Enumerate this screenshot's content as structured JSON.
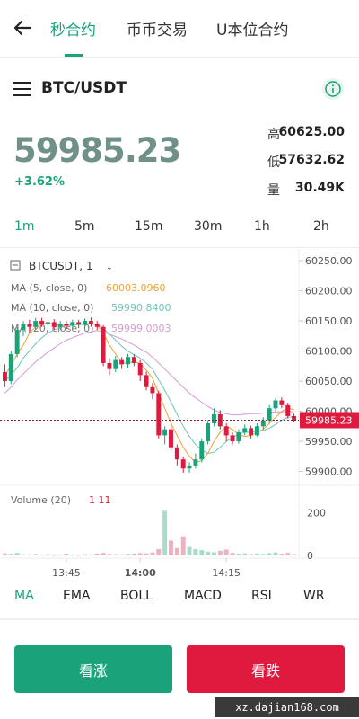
{
  "nav": {
    "tabs": [
      {
        "label": "秒合约",
        "active": true
      },
      {
        "label": "币币交易",
        "active": false
      },
      {
        "label": "U本位合约",
        "active": false
      }
    ]
  },
  "pair": {
    "name": "BTC/USDT"
  },
  "ticker": {
    "price": "59985.23",
    "change": "+3.62%",
    "high_label": "高",
    "high": "60625.00",
    "low_label": "低",
    "low": "57632.62",
    "vol_label": "量",
    "vol": "30.49K"
  },
  "intervals": [
    "1m",
    "5m",
    "15m",
    "30m",
    "1h",
    "2h"
  ],
  "active_interval": "1m",
  "chart_header": {
    "symbol": "BTCUSDT, 1",
    "ma5_label": "MA (5, close, 0)",
    "ma5_value": "60003.0960",
    "ma10_label": "MA (10, close, 0)",
    "ma10_value": "59990.8400",
    "ma20_label": "MA (20, close, 0)",
    "ma20_value": "59999.0003",
    "volume_label": "Volume (20)",
    "volume_value": "1 11"
  },
  "chart_data": {
    "type": "candlestick",
    "price_axis_ticks": [
      "60250.00",
      "60200.00",
      "60150.00",
      "60100.00",
      "60050.00",
      "60000.00",
      "59950.00",
      "59900.00"
    ],
    "price_range": [
      59880,
      60265
    ],
    "current_price": "59985.23",
    "volume_axis_ticks": [
      "200",
      "0"
    ],
    "volume_range": [
      0,
      220
    ],
    "time_ticks": [
      "13:45",
      "14:00",
      "14:15"
    ],
    "candles": [
      {
        "o": 60065,
        "c": 60050,
        "h": 60078,
        "l": 60040,
        "v": 10
      },
      {
        "o": 60050,
        "c": 60095,
        "h": 60100,
        "l": 60045,
        "v": 8
      },
      {
        "o": 60095,
        "c": 60135,
        "h": 60140,
        "l": 60090,
        "v": 12
      },
      {
        "o": 60135,
        "c": 60145,
        "h": 60150,
        "l": 60125,
        "v": 6
      },
      {
        "o": 60145,
        "c": 60140,
        "h": 60152,
        "l": 60130,
        "v": 5
      },
      {
        "o": 60140,
        "c": 60150,
        "h": 60155,
        "l": 60135,
        "v": 7
      },
      {
        "o": 60150,
        "c": 60145,
        "h": 60155,
        "l": 60140,
        "v": 4
      },
      {
        "o": 60145,
        "c": 60148,
        "h": 60152,
        "l": 60140,
        "v": 6
      },
      {
        "o": 60148,
        "c": 60140,
        "h": 60153,
        "l": 60135,
        "v": 3
      },
      {
        "o": 60140,
        "c": 60145,
        "h": 60150,
        "l": 60135,
        "v": 5
      },
      {
        "o": 60145,
        "c": 60142,
        "h": 60150,
        "l": 60136,
        "v": 8
      },
      {
        "o": 60142,
        "c": 60148,
        "h": 60152,
        "l": 60138,
        "v": 4
      },
      {
        "o": 60148,
        "c": 60144,
        "h": 60152,
        "l": 60138,
        "v": 3
      },
      {
        "o": 60144,
        "c": 60150,
        "h": 60154,
        "l": 60140,
        "v": 6
      },
      {
        "o": 60150,
        "c": 60145,
        "h": 60156,
        "l": 60140,
        "v": 5
      },
      {
        "o": 60145,
        "c": 60140,
        "h": 60150,
        "l": 60135,
        "v": 9
      },
      {
        "o": 60140,
        "c": 60080,
        "h": 60143,
        "l": 60075,
        "v": 12
      },
      {
        "o": 60080,
        "c": 60070,
        "h": 60088,
        "l": 60060,
        "v": 7
      },
      {
        "o": 60070,
        "c": 60085,
        "h": 60092,
        "l": 60065,
        "v": 6
      },
      {
        "o": 60085,
        "c": 60078,
        "h": 60090,
        "l": 60070,
        "v": 5
      },
      {
        "o": 60078,
        "c": 60090,
        "h": 60095,
        "l": 60072,
        "v": 8
      },
      {
        "o": 60090,
        "c": 60080,
        "h": 60095,
        "l": 60075,
        "v": 9
      },
      {
        "o": 60080,
        "c": 60060,
        "h": 60085,
        "l": 60050,
        "v": 11
      },
      {
        "o": 60060,
        "c": 60040,
        "h": 60066,
        "l": 60035,
        "v": 10
      },
      {
        "o": 60040,
        "c": 60030,
        "h": 60047,
        "l": 60020,
        "v": 14
      },
      {
        "o": 60030,
        "c": 59960,
        "h": 60034,
        "l": 59955,
        "v": 30
      },
      {
        "o": 59960,
        "c": 59970,
        "h": 59975,
        "l": 59945,
        "v": 210
      },
      {
        "o": 59970,
        "c": 59940,
        "h": 59975,
        "l": 59935,
        "v": 70
      },
      {
        "o": 59940,
        "c": 59920,
        "h": 59945,
        "l": 59910,
        "v": 35
      },
      {
        "o": 59920,
        "c": 59905,
        "h": 59925,
        "l": 59898,
        "v": 90
      },
      {
        "o": 59905,
        "c": 59910,
        "h": 59915,
        "l": 59898,
        "v": 40
      },
      {
        "o": 59910,
        "c": 59920,
        "h": 59930,
        "l": 59905,
        "v": 30
      },
      {
        "o": 59920,
        "c": 59950,
        "h": 59955,
        "l": 59915,
        "v": 25
      },
      {
        "o": 59950,
        "c": 59980,
        "h": 59985,
        "l": 59945,
        "v": 18
      },
      {
        "o": 59980,
        "c": 59995,
        "h": 60005,
        "l": 59975,
        "v": 15
      },
      {
        "o": 59995,
        "c": 59975,
        "h": 60002,
        "l": 59970,
        "v": 22
      },
      {
        "o": 59975,
        "c": 59960,
        "h": 59980,
        "l": 59950,
        "v": 28
      },
      {
        "o": 59960,
        "c": 59950,
        "h": 59965,
        "l": 59945,
        "v": 12
      },
      {
        "o": 59950,
        "c": 59965,
        "h": 59970,
        "l": 59946,
        "v": 8
      },
      {
        "o": 59965,
        "c": 59972,
        "h": 59978,
        "l": 59960,
        "v": 10
      },
      {
        "o": 59972,
        "c": 59960,
        "h": 59976,
        "l": 59955,
        "v": 6
      },
      {
        "o": 59960,
        "c": 59975,
        "h": 59980,
        "l": 59958,
        "v": 9
      },
      {
        "o": 59975,
        "c": 59985,
        "h": 59990,
        "l": 59970,
        "v": 7
      },
      {
        "o": 59985,
        "c": 60005,
        "h": 60010,
        "l": 59980,
        "v": 11
      },
      {
        "o": 60005,
        "c": 60018,
        "h": 60022,
        "l": 60000,
        "v": 14
      },
      {
        "o": 60018,
        "c": 60010,
        "h": 60023,
        "l": 60005,
        "v": 8
      },
      {
        "o": 60010,
        "c": 59992,
        "h": 60014,
        "l": 59988,
        "v": 12
      },
      {
        "o": 59992,
        "c": 59985,
        "h": 59996,
        "l": 59982,
        "v": 6
      }
    ],
    "ma5": [
      60060,
      60075,
      60095,
      60110,
      60130,
      60140,
      60145,
      60146,
      60145,
      60143,
      60143,
      60144,
      60145,
      60145,
      60146,
      60144,
      60130,
      60110,
      60095,
      60080,
      60080,
      60083,
      60079,
      60068,
      60055,
      60030,
      60005,
      59980,
      59960,
      59940,
      59925,
      59915,
      59918,
      59930,
      59950,
      59965,
      59975,
      59970,
      59962,
      59958,
      59960,
      59965,
      59970,
      59980,
      59990,
      60000,
      60005,
      60003
    ],
    "ma10": [
      60050,
      60060,
      60072,
      60088,
      60100,
      60112,
      60122,
      60130,
      60135,
      60140,
      60142,
      60143,
      60144,
      60144,
      60145,
      60144,
      60138,
      60128,
      60118,
      60108,
      60100,
      60094,
      60088,
      60080,
      60070,
      60052,
      60035,
      60015,
      59995,
      59975,
      59958,
      59945,
      59935,
      59930,
      59932,
      59940,
      59950,
      59956,
      59962,
      59965,
      59965,
      59966,
      59968,
      59972,
      59978,
      59985,
      59990,
      59991
    ],
    "ma20": [
      60030,
      60040,
      60052,
      60062,
      60072,
      60082,
      60090,
      60098,
      60105,
      60112,
      60118,
      60122,
      60126,
      60130,
      60132,
      60134,
      60132,
      60128,
      60124,
      60120,
      60115,
      60110,
      60104,
      60098,
      60090,
      60080,
      60070,
      60060,
      60050,
      60040,
      60030,
      60022,
      60015,
      60008,
      60002,
      59998,
      59996,
      59994,
      59994,
      59995,
      59996,
      59996,
      59997,
      59998,
      59999,
      59999,
      60000,
      59999
    ]
  },
  "indicators": [
    "MA",
    "EMA",
    "BOLL",
    "MACD",
    "RSI",
    "WR"
  ],
  "active_indicator": "MA",
  "actions": {
    "up_label": "看涨",
    "down_label": "看跌"
  },
  "watermark": "xz.dajian168.com",
  "colors": {
    "accent": "#1aa37a",
    "bull": "#1aa37a",
    "bear": "#e0193f",
    "price": "#70908a",
    "ma5": "#f0a030",
    "ma10": "#6ec4b8",
    "ma20": "#d49ad4"
  }
}
